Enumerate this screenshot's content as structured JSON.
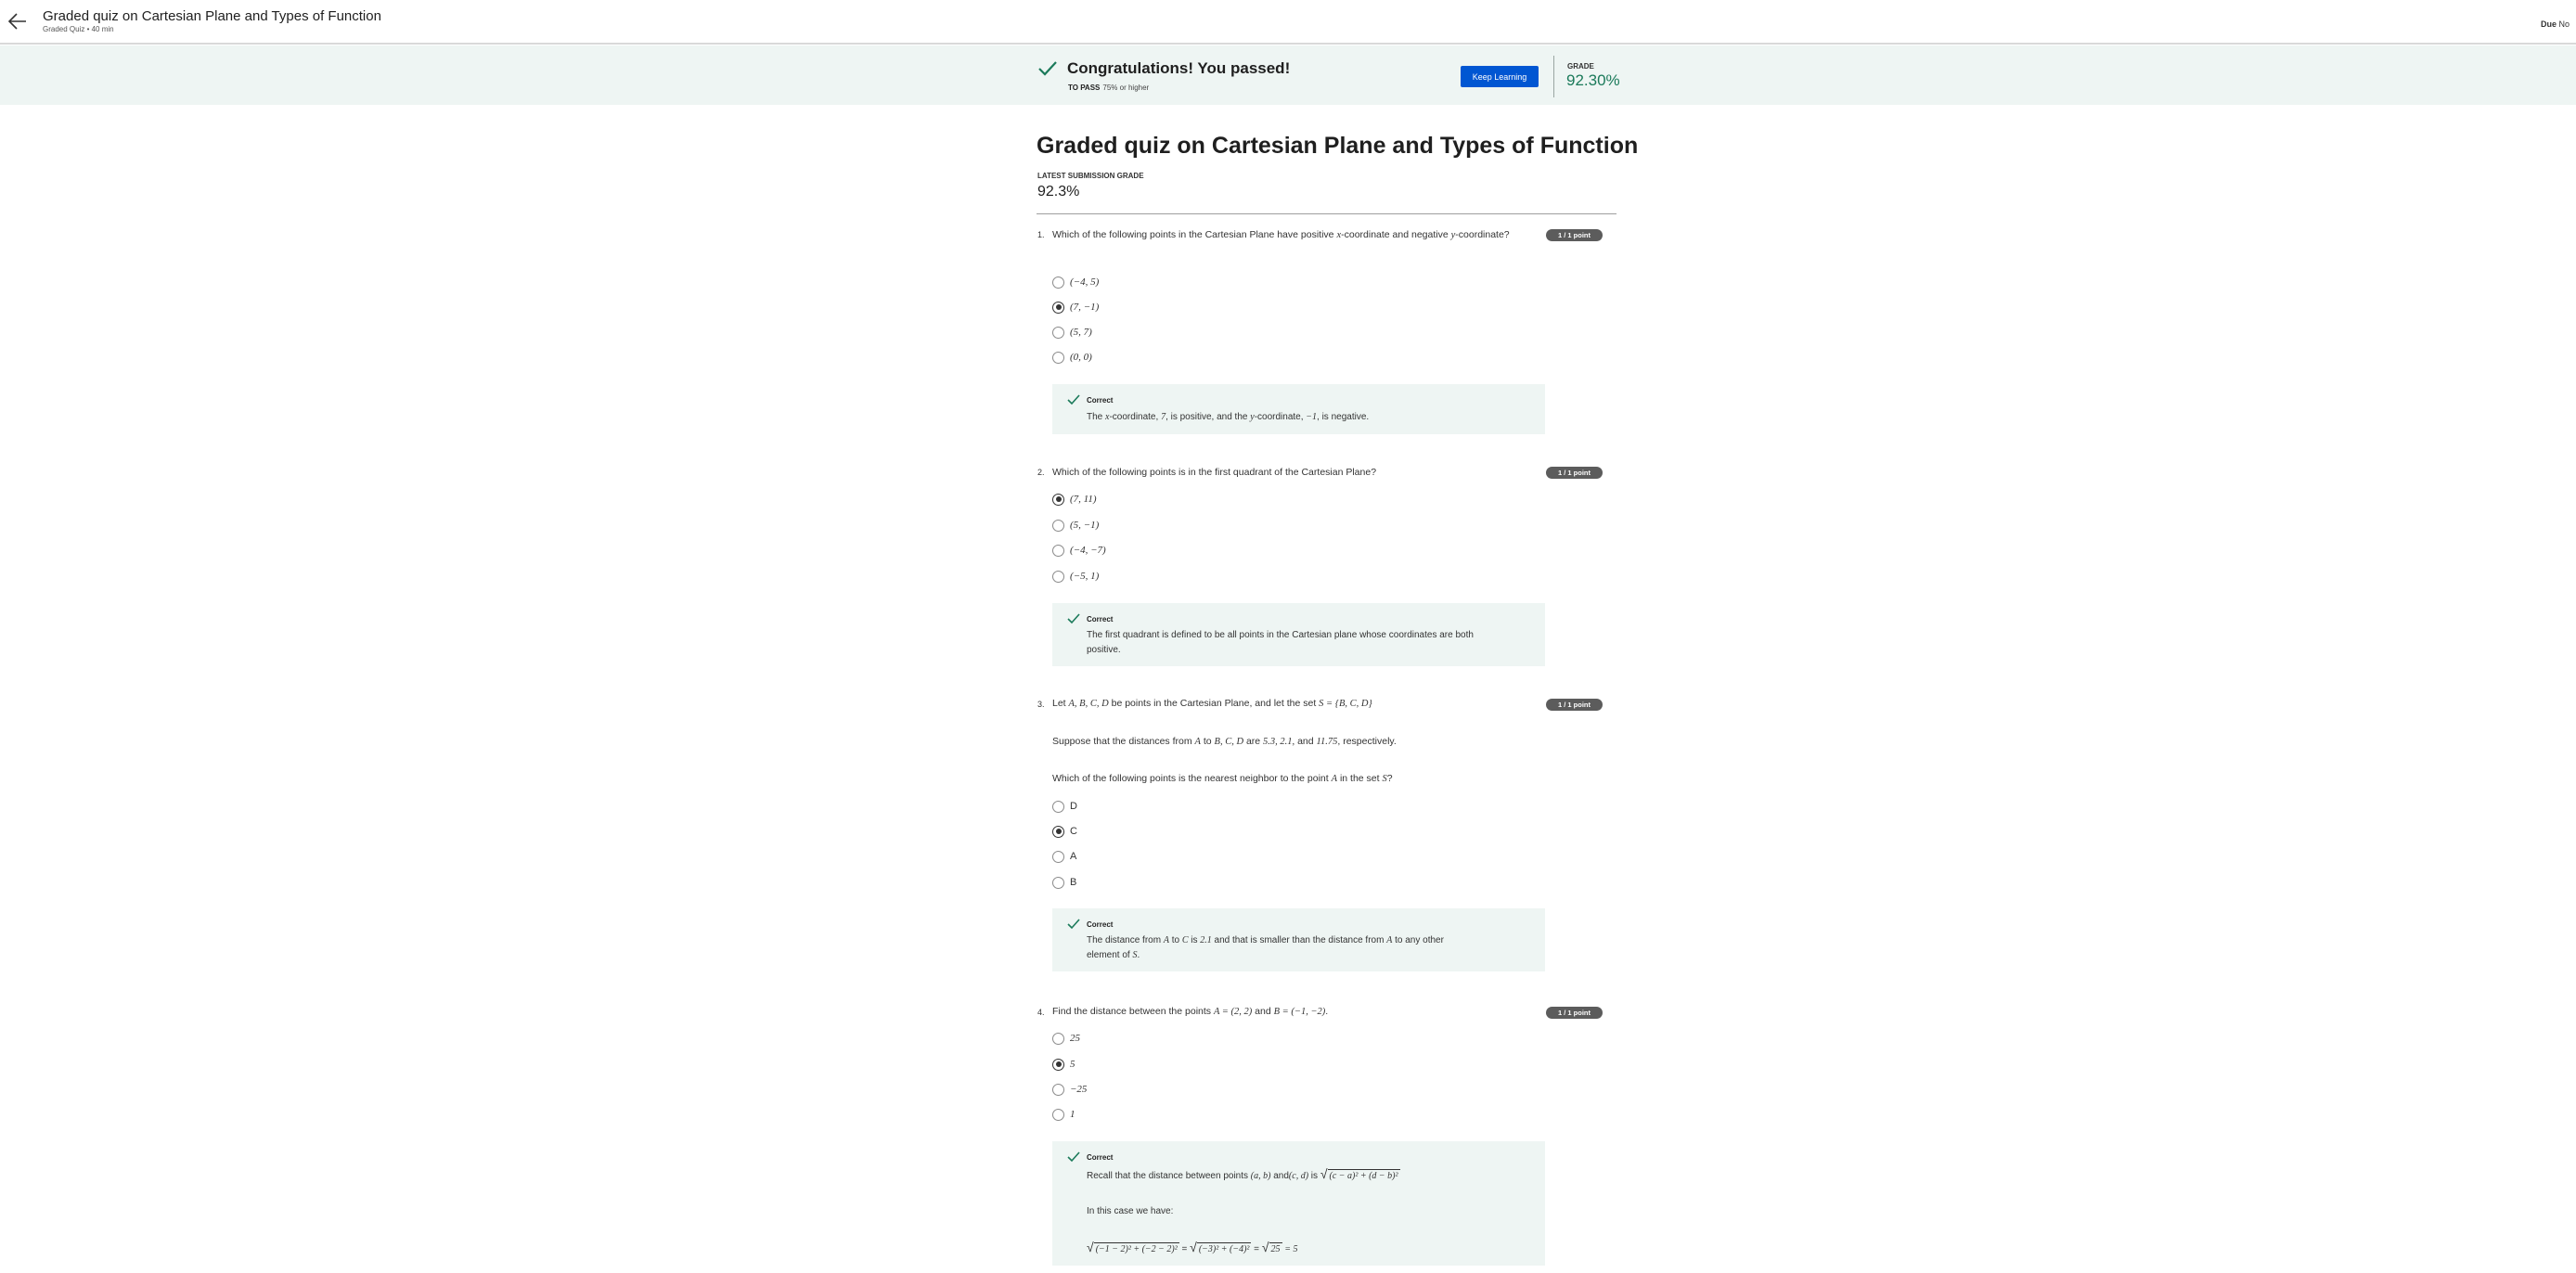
{
  "header": {
    "title": "Graded quiz on Cartesian Plane and Types of Function",
    "subtitle": "Graded Quiz • 40 min",
    "due_label": "Due",
    "due_value": "No"
  },
  "banner": {
    "message": "Congratulations! You passed!",
    "to_pass_label": "TO PASS",
    "to_pass_value": "75% or higher",
    "button": "Keep Learning",
    "grade_label": "GRADE",
    "grade_value": "92.30%"
  },
  "main": {
    "title": "Graded quiz on Cartesian Plane and Types of Function",
    "latest_label": "LATEST SUBMISSION GRADE",
    "latest_value": "92.3%"
  },
  "questions": [
    {
      "number": "1.",
      "text": {
        "p1": "Which of the following points in the Cartesian Plane have positive ",
        "v1": "x",
        "p2": "-coordinate and negative ",
        "v2": "y",
        "p3": "-coordinate?"
      },
      "points": "1 / 1 point",
      "options": [
        "(−4, 5)",
        "(7, −1)",
        "(5, 7)",
        "(0, 0)"
      ],
      "selected": 1,
      "feedback_title": "Correct",
      "feedback": {
        "p1": "The ",
        "v1": "x",
        "p2": "-coordinate, ",
        "v2": "7",
        "p3": ", is positive, and the ",
        "v3": "y",
        "p4": "-coordinate, ",
        "v4": "−1",
        "p5": ", is negative."
      }
    },
    {
      "number": "2.",
      "text": "Which of the following points is in the first quadrant of the Cartesian Plane?",
      "points": "1 / 1 point",
      "options": [
        "(7, 11)",
        "(5, −1)",
        "(−4, −7)",
        "(−5, 1)"
      ],
      "selected": 0,
      "feedback_title": "Correct",
      "feedback_line1": "The first quadrant is defined to be all points in the Cartesian plane whose coordinates are both",
      "feedback_line2": "positive."
    },
    {
      "number": "3.",
      "text": {
        "p1": "Let ",
        "v1": "A, B, C, D",
        "p2": " be points in the Cartesian Plane, and let the set ",
        "v2": "S = {B, C, D}"
      },
      "points": "1 / 1 point",
      "line2": {
        "p1": "Suppose that the distances from ",
        "v1": "A",
        "p2": " to ",
        "v2": "B, C, D",
        "p3": " are ",
        "v3": "5.3, 2.1,",
        "p4": " and ",
        "v4": "11.75",
        "p5": ", respectively."
      },
      "line3": {
        "p1": "Which of the following points is the nearest neighbor to the point ",
        "v1": "A",
        "p2": " in the set ",
        "v2": "S",
        "p3": "?"
      },
      "options": [
        "D",
        "C",
        "A",
        "B"
      ],
      "selected": 1,
      "feedback_title": "Correct",
      "feedback": {
        "p1": "The distance from ",
        "v1": "A",
        "p2": " to ",
        "v2": "C",
        "p3": " is ",
        "v3": "2.1",
        "p4": " and that is smaller than the distance from ",
        "v4": "A",
        "p5": " to any other",
        "p6": "element of ",
        "v5": "S",
        "p7": "."
      }
    },
    {
      "number": "4.",
      "text": {
        "p1": "Find the distance between the points ",
        "v1": "A = (2, 2)",
        "p2": " and ",
        "v2": "B = (−1, −2)",
        "p3": "."
      },
      "points": "1 / 1 point",
      "options": [
        "25",
        "5",
        "−25",
        "1"
      ],
      "selected": 1,
      "feedback_title": "Correct",
      "feedback": {
        "p1": "Recall that the distance between points ",
        "v1": "(a, b)",
        "p2": " and",
        "v2": "(c, d)",
        "p3": " is ",
        "sqrt1": "(c − a)² + (d − b)²",
        "line2": "In this case we have:",
        "eq_a": "(−1 − 2)² + (−2 − 2)²",
        "eq_b": "(−3)² + (−4)²",
        "eq_c": "25",
        "eq_end": "= 5"
      }
    }
  ],
  "colors": {
    "accent": "#0056d2",
    "success": "#1b7a5a",
    "banner_bg": "#eef5f3",
    "points_badge": "#5c5c5c"
  },
  "icons": [
    "back-arrow-icon",
    "check-icon"
  ]
}
